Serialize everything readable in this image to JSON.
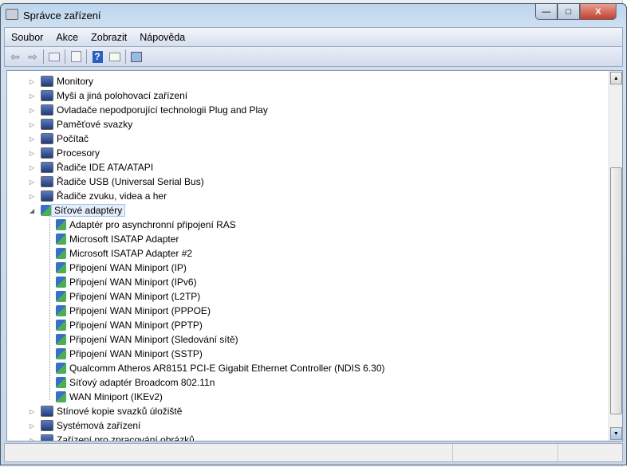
{
  "window": {
    "title": "Správce zařízení",
    "minimize": "—",
    "maximize": "□",
    "close": "X"
  },
  "menu": [
    "Soubor",
    "Akce",
    "Zobrazit",
    "Nápověda"
  ],
  "toolbar": {
    "back": "⇦",
    "forward": "⇨",
    "help": "?"
  },
  "tree": [
    {
      "label": "Monitory",
      "level": 0,
      "state": "collapsed"
    },
    {
      "label": "Myši a jiná polohovací zařízení",
      "level": 0,
      "state": "collapsed"
    },
    {
      "label": "Ovladače nepodporující technologii Plug and Play",
      "level": 0,
      "state": "collapsed"
    },
    {
      "label": "Paměťové svazky",
      "level": 0,
      "state": "collapsed"
    },
    {
      "label": "Počítač",
      "level": 0,
      "state": "collapsed"
    },
    {
      "label": "Procesory",
      "level": 0,
      "state": "collapsed"
    },
    {
      "label": "Řadiče IDE ATA/ATAPI",
      "level": 0,
      "state": "collapsed"
    },
    {
      "label": "Řadiče USB (Universal Serial Bus)",
      "level": 0,
      "state": "collapsed"
    },
    {
      "label": "Řadiče zvuku, videa a her",
      "level": 0,
      "state": "collapsed"
    },
    {
      "label": "Síťové adaptéry",
      "level": 0,
      "state": "expanded",
      "selected": true
    },
    {
      "label": "Adaptér pro asynchronní připojení RAS",
      "level": 1
    },
    {
      "label": "Microsoft ISATAP Adapter",
      "level": 1
    },
    {
      "label": "Microsoft ISATAP Adapter #2",
      "level": 1
    },
    {
      "label": "Připojení WAN Miniport (IP)",
      "level": 1
    },
    {
      "label": "Připojení WAN Miniport (IPv6)",
      "level": 1
    },
    {
      "label": "Připojení WAN Miniport (L2TP)",
      "level": 1
    },
    {
      "label": "Připojení WAN Miniport (PPPOE)",
      "level": 1
    },
    {
      "label": "Připojení WAN Miniport (PPTP)",
      "level": 1
    },
    {
      "label": "Připojení WAN Miniport (Sledování sítě)",
      "level": 1
    },
    {
      "label": "Připojení WAN Miniport (SSTP)",
      "level": 1
    },
    {
      "label": "Qualcomm Atheros AR8151 PCI-E Gigabit Ethernet Controller (NDIS 6.30)",
      "level": 1
    },
    {
      "label": "Síťový adaptér Broadcom 802.11n",
      "level": 1
    },
    {
      "label": "WAN Miniport (IKEv2)",
      "level": 1
    },
    {
      "label": "Stínové kopie svazků úložiště",
      "level": 0,
      "state": "collapsed"
    },
    {
      "label": "Systémová zařízení",
      "level": 0,
      "state": "collapsed"
    },
    {
      "label": "Zařízení pro zpracování obrázků",
      "level": 0,
      "state": "collapsed"
    }
  ]
}
